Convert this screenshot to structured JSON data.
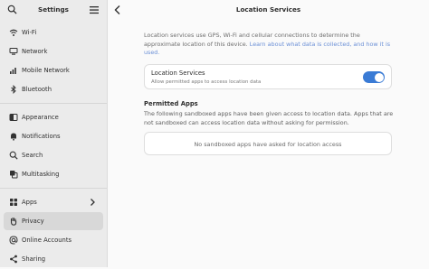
{
  "sidebar": {
    "title": "Settings",
    "items_group1": [
      {
        "label": "Wi-Fi",
        "icon": "wifi-icon"
      },
      {
        "label": "Network",
        "icon": "network-icon"
      },
      {
        "label": "Mobile Network",
        "icon": "mobile-network-icon"
      },
      {
        "label": "Bluetooth",
        "icon": "bluetooth-icon"
      }
    ],
    "items_group2": [
      {
        "label": "Appearance",
        "icon": "appearance-icon"
      },
      {
        "label": "Notifications",
        "icon": "bell-icon"
      },
      {
        "label": "Search",
        "icon": "search-icon"
      },
      {
        "label": "Multitasking",
        "icon": "multitasking-icon"
      }
    ],
    "items_group3": [
      {
        "label": "Apps",
        "icon": "apps-icon"
      },
      {
        "label": "Privacy",
        "icon": "hand-icon",
        "selected": true
      },
      {
        "label": "Online Accounts",
        "icon": "at-icon"
      },
      {
        "label": "Sharing",
        "icon": "share-icon"
      }
    ]
  },
  "main": {
    "title": "Location Services",
    "description_text": "Location services use GPS, Wi-Fi and cellular connections to determine the approximate location of this device.",
    "description_link": "Learn about what data is collected, and how it is used.",
    "location_services": {
      "title": "Location Services",
      "subtitle": "Allow permitted apps to access location data",
      "enabled": true
    },
    "permitted_apps": {
      "title": "Permitted Apps",
      "description": "The following sandboxed apps have been given access to location data. Apps that are not sandboxed can access location data without asking for permission.",
      "empty_text": "No sandboxed apps have asked for location access"
    }
  },
  "colors": {
    "accent": "#3a7bd5",
    "link": "#6a8fd6"
  }
}
